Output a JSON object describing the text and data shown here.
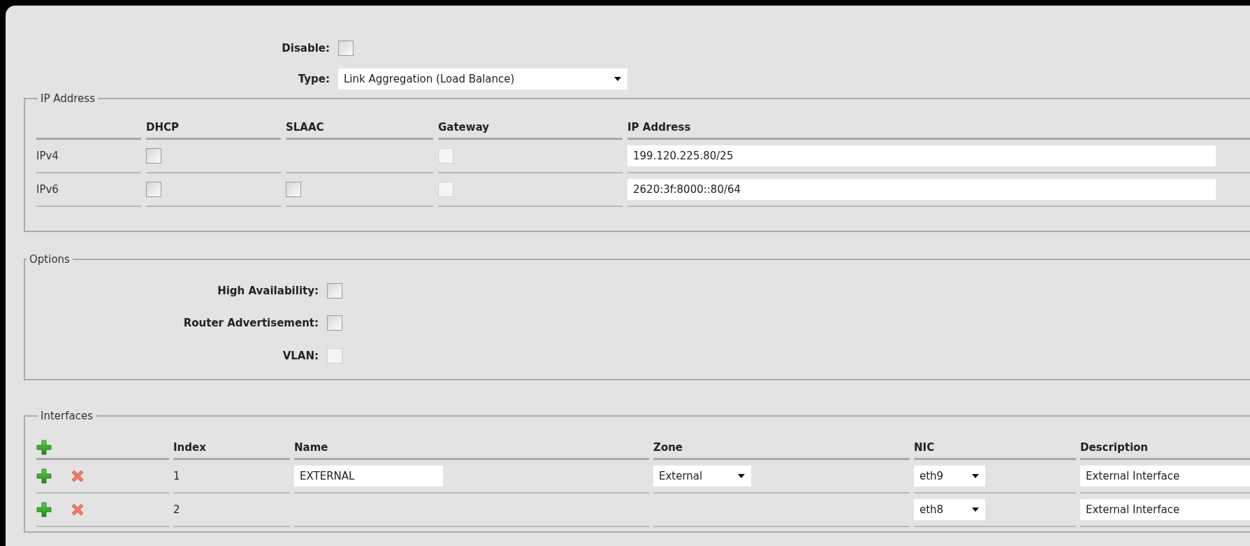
{
  "disable": {
    "label": "Disable:",
    "checked": false
  },
  "type": {
    "label": "Type:",
    "value": "Link Aggregation (Load Balance)"
  },
  "ip_address": {
    "legend": "IP Address",
    "columns": [
      "DHCP",
      "SLAAC",
      "Gateway",
      "IP Address"
    ],
    "rows": [
      {
        "label": "IPv4",
        "dhcp": {
          "checked": false,
          "disabled": false
        },
        "gateway": {
          "checked": false,
          "disabled": true
        },
        "address": "199.120.225.80/25"
      },
      {
        "label": "IPv6",
        "dhcp": {
          "checked": false,
          "disabled": false
        },
        "slaac": {
          "checked": false,
          "disabled": false
        },
        "gateway": {
          "checked": false,
          "disabled": true
        },
        "address": "2620:3f:8000::80/64"
      }
    ]
  },
  "options": {
    "legend": "Options",
    "items": [
      {
        "label": "High Availability:",
        "checked": false,
        "disabled": false
      },
      {
        "label": "Router Advertisement:",
        "checked": false,
        "disabled": false
      },
      {
        "label": "VLAN:",
        "checked": false,
        "disabled": true
      }
    ]
  },
  "interfaces": {
    "legend": "Interfaces",
    "columns": [
      "Index",
      "Name",
      "Zone",
      "NIC",
      "Description"
    ],
    "rows": [
      {
        "index": "1",
        "name": "EXTERNAL",
        "zone": "External",
        "nic": "eth9",
        "description": "External Interface"
      },
      {
        "index": "2",
        "nic": "eth8",
        "description": "External Interface"
      }
    ]
  }
}
